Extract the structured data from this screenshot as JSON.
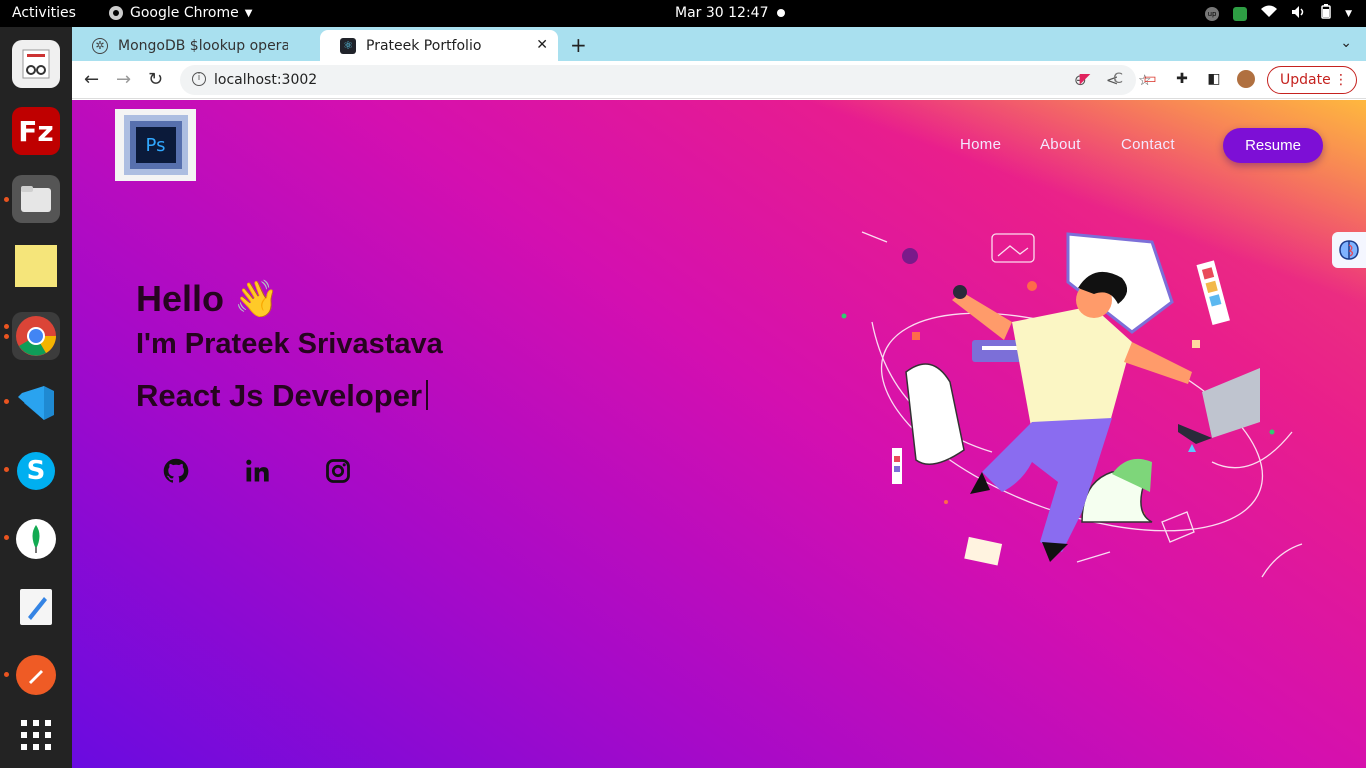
{
  "system": {
    "activities": "Activities",
    "app_menu": "Google Chrome",
    "clock": "Mar 30  12:47"
  },
  "dock": {
    "apps": [
      "system-monitor-icon",
      "filezilla-icon",
      "files-icon",
      "sticky-notes-icon",
      "chrome-icon",
      "vscode-icon",
      "skype-icon",
      "mongodb-compass-icon",
      "text-editor-icon",
      "postman-icon",
      "show-apps-icon"
    ]
  },
  "browser": {
    "tabs": [
      {
        "title": "MongoDB $lookup operat",
        "active": false
      },
      {
        "title": "Prateek Portfolio",
        "active": true
      }
    ],
    "url": "localhost:3002",
    "update_label": "Update"
  },
  "page": {
    "nav": [
      "Home",
      "About",
      "Contact"
    ],
    "resume_label": "Resume",
    "logo_text": "Ps",
    "hello": "Hello 👋",
    "name": "I'm Prateek Srivastava",
    "role": "React Js Developer",
    "social": [
      "github-icon",
      "linkedin-icon",
      "instagram-icon"
    ]
  },
  "colors": {
    "tabstrip": "#a9e0ef",
    "resume_button": "#7d0fd6",
    "hero_text": "#26041f",
    "gradient_start": "#6a0be0",
    "gradient_end": "#ef4470"
  }
}
